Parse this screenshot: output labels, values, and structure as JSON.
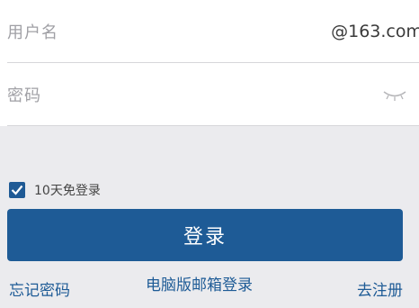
{
  "form": {
    "username_label": "用户名",
    "username_value": "@163.com",
    "password_label": "密码"
  },
  "icons": {
    "password_toggle": "eye-closed-icon",
    "checkbox": "checkmark-icon"
  },
  "remember": {
    "label": "10天免登录",
    "checked": true
  },
  "login_button": "登录",
  "links": {
    "forgot_password": "忘记密码",
    "pc_mailbox_login": "电脑版邮箱登录",
    "register": "去注册"
  },
  "colors": {
    "accent": "#1e5b96",
    "background": "#ebebee",
    "field_bg": "#ffffff"
  }
}
